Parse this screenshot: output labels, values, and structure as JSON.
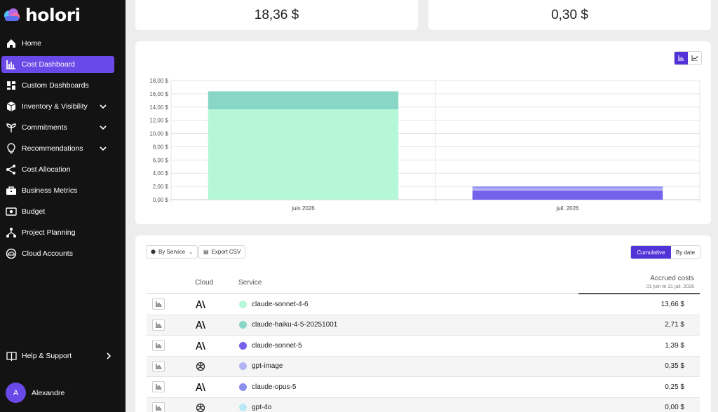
{
  "app": {
    "name": "holori"
  },
  "nav": {
    "items": [
      {
        "label": "Home",
        "icon": "home-icon"
      },
      {
        "label": "Cost Dashboard",
        "icon": "bar-chart-icon",
        "active": true
      },
      {
        "label": "Custom Dashboards",
        "icon": "dashboard-grid-icon"
      },
      {
        "label": "Inventory & Visibility",
        "icon": "cube-icon",
        "expandable": true
      },
      {
        "label": "Commitments",
        "icon": "plant-icon",
        "expandable": true
      },
      {
        "label": "Recommendations",
        "icon": "lightbulb-icon",
        "expandable": true
      },
      {
        "label": "Cost Allocation",
        "icon": "share-icon"
      },
      {
        "label": "Business Metrics",
        "icon": "briefcase-icon"
      },
      {
        "label": "Budget",
        "icon": "money-icon"
      },
      {
        "label": "Project Planning",
        "icon": "hierarchy-icon"
      },
      {
        "label": "Cloud Accounts",
        "icon": "cloud-circle-icon"
      }
    ],
    "help": "Help & Support",
    "user": {
      "initial": "A",
      "name": "Alexandre"
    }
  },
  "kpis": [
    {
      "value": "18,36 $"
    },
    {
      "value": "0,30 $"
    }
  ],
  "chart_data": {
    "type": "bar",
    "stacked": true,
    "categories": [
      "juin 2026",
      "juil. 2026"
    ],
    "series": [
      {
        "name": "claude-sonnet-4-6",
        "color": "#b6f7d8",
        "values": [
          13.66,
          0
        ]
      },
      {
        "name": "claude-haiku-4-5-20251001",
        "color": "#88d6c6",
        "values": [
          2.71,
          0
        ]
      },
      {
        "name": "claude-sonnet-5",
        "color": "#7561eb",
        "values": [
          0,
          1.39
        ]
      },
      {
        "name": "gpt-image",
        "color": "#b3b4f5",
        "values": [
          0,
          0.35
        ]
      },
      {
        "name": "claude-opus-5",
        "color": "#8b8ff0",
        "values": [
          0,
          0.25
        ]
      }
    ],
    "ylim": [
      0,
      18
    ],
    "yticks": [
      "0,00 $",
      "2,00 $",
      "4,00 $",
      "6,00 $",
      "8,00 $",
      "10,00 $",
      "12,00 $",
      "14,00 $",
      "16,00 $",
      "18,00 $"
    ],
    "grid": true,
    "legend": "none"
  },
  "table": {
    "group_by_label": "By Service",
    "export_label": "Export CSV",
    "mode_cumulative": "Cumulative",
    "mode_by_date": "By date",
    "headers": {
      "cloud": "Cloud",
      "service": "Service",
      "cost": "Accrued costs",
      "period": "01 juin to 31 juil. 2026"
    },
    "rows": [
      {
        "cloud": "anthropic-icon",
        "color": "#b6f7d8",
        "service": "claude-sonnet-4-6",
        "cost": "13,66 $"
      },
      {
        "cloud": "anthropic-icon",
        "color": "#88d6c6",
        "service": "claude-haiku-4-5-20251001",
        "cost": "2,71 $"
      },
      {
        "cloud": "anthropic-icon",
        "color": "#7561eb",
        "service": "claude-sonnet-5",
        "cost": "1,39 $"
      },
      {
        "cloud": "openai-icon",
        "color": "#b3b4f5",
        "service": "gpt-image",
        "cost": "0,35 $"
      },
      {
        "cloud": "anthropic-icon",
        "color": "#8b8ff0",
        "service": "claude-opus-5",
        "cost": "0,25 $"
      },
      {
        "cloud": "openai-icon",
        "color": "#b8e9f7",
        "service": "gpt-4o",
        "cost": "0,00 $"
      }
    ]
  }
}
